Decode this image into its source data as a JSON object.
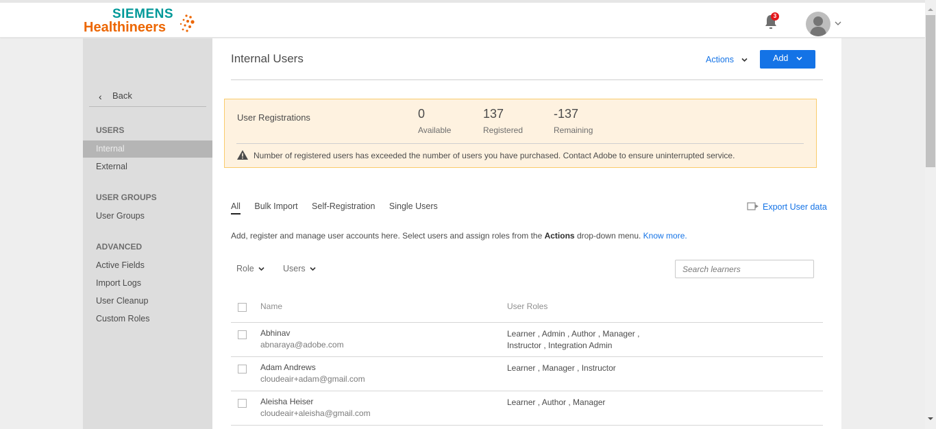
{
  "brand": {
    "line1": "SIEMENS",
    "line2": "Healthineers",
    "colors": {
      "teal": "#009999",
      "orange": "#ec6602"
    }
  },
  "header": {
    "notification_count": "3",
    "icons": [
      "bell-icon",
      "avatar-icon",
      "chevron-down-icon"
    ]
  },
  "sidebar": {
    "back_label": "Back",
    "sections": [
      {
        "heading": "USERS",
        "items": [
          {
            "label": "Internal",
            "active": true
          },
          {
            "label": "External",
            "active": false
          }
        ]
      },
      {
        "heading": "USER GROUPS",
        "items": [
          {
            "label": "User Groups",
            "active": false
          }
        ]
      },
      {
        "heading": "ADVANCED",
        "items": [
          {
            "label": "Active Fields"
          },
          {
            "label": "Import Logs"
          },
          {
            "label": "User Cleanup"
          },
          {
            "label": "Custom Roles"
          }
        ]
      }
    ]
  },
  "main": {
    "title": "Internal Users",
    "actions_label": "Actions",
    "add_label": "Add",
    "accent_color": "#1473e6",
    "registrations": {
      "label": "User Registrations",
      "stats": [
        {
          "value": "0",
          "caption": "Available"
        },
        {
          "value": "137",
          "caption": "Registered"
        },
        {
          "value": "-137",
          "caption": "Remaining"
        }
      ],
      "warning": "Number of registered users has exceeded the number of users you have purchased. Contact Adobe to ensure uninterrupted service."
    },
    "tabs": [
      {
        "label": "All",
        "active": true
      },
      {
        "label": "Bulk Import",
        "active": false
      },
      {
        "label": "Self-Registration",
        "active": false
      },
      {
        "label": "Single Users",
        "active": false
      }
    ],
    "export_label": "Export User data",
    "description": {
      "before": "Add, register and manage user accounts here. Select users and assign roles from the ",
      "bold": "Actions",
      "after": " drop-down menu. ",
      "link": "Know more."
    },
    "filters": {
      "role_label": "Role",
      "users_label": "Users"
    },
    "search_placeholder": "Search learners",
    "table": {
      "columns": [
        "Name",
        "User Roles"
      ],
      "rows": [
        {
          "name": "Abhinav",
          "email": "abnaraya@adobe.com",
          "roles": "Learner , Admin , Author , Manager , Instructor , Integration Admin"
        },
        {
          "name": "Adam Andrews",
          "email": "cloudeair+adam@gmail.com",
          "roles": "Learner , Manager , Instructor"
        },
        {
          "name": "Aleisha Heiser",
          "email": "cloudeair+aleisha@gmail.com",
          "roles": "Learner , Author , Manager"
        }
      ]
    }
  }
}
